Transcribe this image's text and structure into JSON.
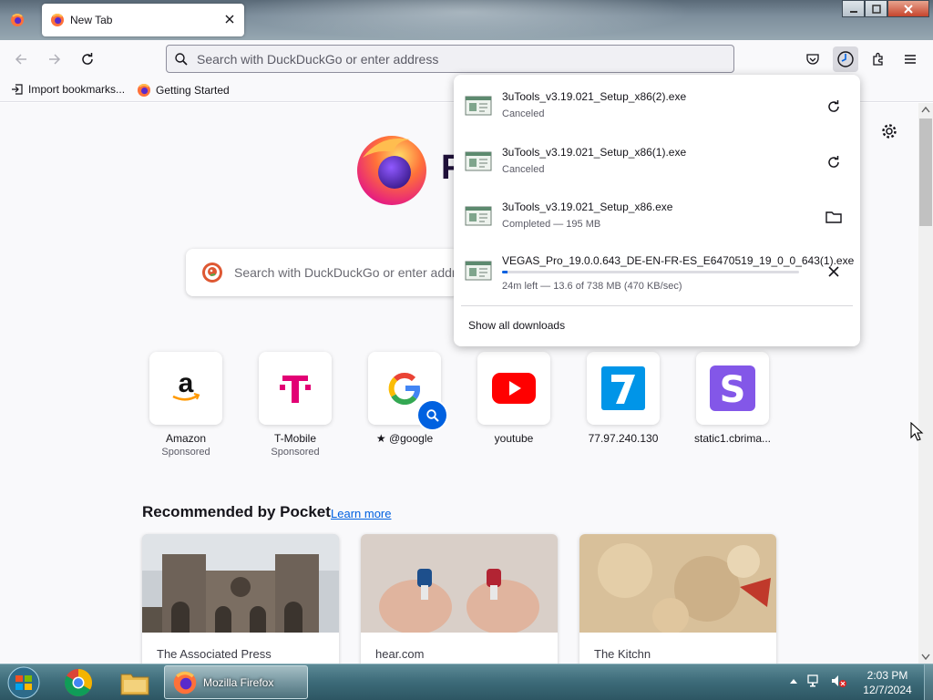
{
  "browser": {
    "tab_title": "New Tab",
    "window_controls": {
      "minimize": "–",
      "maximize": "□",
      "close": "✕"
    }
  },
  "navbar": {
    "url_placeholder": "Search with DuckDuckGo or enter address",
    "icons": [
      "back-icon",
      "forward-icon",
      "reload-icon",
      "pocket-icon",
      "downloads-icon",
      "extensions-icon",
      "menu-icon"
    ]
  },
  "bookmarks": [
    {
      "label": "Import bookmarks...",
      "icon": "import-icon"
    },
    {
      "label": "Getting Started",
      "icon": "firefox-icon"
    }
  ],
  "newtab": {
    "logo_text": "F",
    "search_placeholder": "Search with DuckDuckGo or enter address",
    "shortcuts": [
      {
        "label": "Amazon",
        "sub": "Sponsored",
        "icon": "amazon-icon"
      },
      {
        "label": "T-Mobile",
        "sub": "Sponsored",
        "icon": "tmobile-icon"
      },
      {
        "label": "@google",
        "sub": "",
        "icon": "google-icon"
      },
      {
        "label": "youtube",
        "sub": "",
        "icon": "youtube-icon"
      },
      {
        "label": "77.97.240.130",
        "sub": "",
        "icon": "seven-icon"
      },
      {
        "label": "static1.cbrima...",
        "sub": "",
        "icon": "s-icon"
      }
    ],
    "pocket": {
      "heading": "Recommended by Pocket",
      "learn_more": "Learn more",
      "cards": [
        {
          "source": "The Associated Press"
        },
        {
          "source": "hear.com"
        },
        {
          "source": "The Kitchn"
        }
      ]
    }
  },
  "downloads": {
    "items": [
      {
        "name": "3uTools_v3.19.021_Setup_x86(2).exe",
        "status": "Canceled",
        "action": "retry-icon"
      },
      {
        "name": "3uTools_v3.19.021_Setup_x86(1).exe",
        "status": "Canceled",
        "action": "retry-icon"
      },
      {
        "name": "3uTools_v3.19.021_Setup_x86.exe",
        "status": "Completed — 195 MB",
        "action": "folder-icon"
      },
      {
        "name": "VEGAS_Pro_19.0.0.643_DE-EN-FR-ES_E6470519_19_0_0_643(1).exe",
        "status": "24m left — 13.6 of 738 MB (470 KB/sec)",
        "action": "cancel-icon",
        "progress": 0.018
      }
    ],
    "show_all": "Show all downloads"
  },
  "taskbar": {
    "active_window": "Mozilla Firefox",
    "time": "2:03 PM",
    "date": "12/7/2024"
  },
  "colors": {
    "accent": "#0061e0",
    "taskbar": "#3c6a78"
  }
}
